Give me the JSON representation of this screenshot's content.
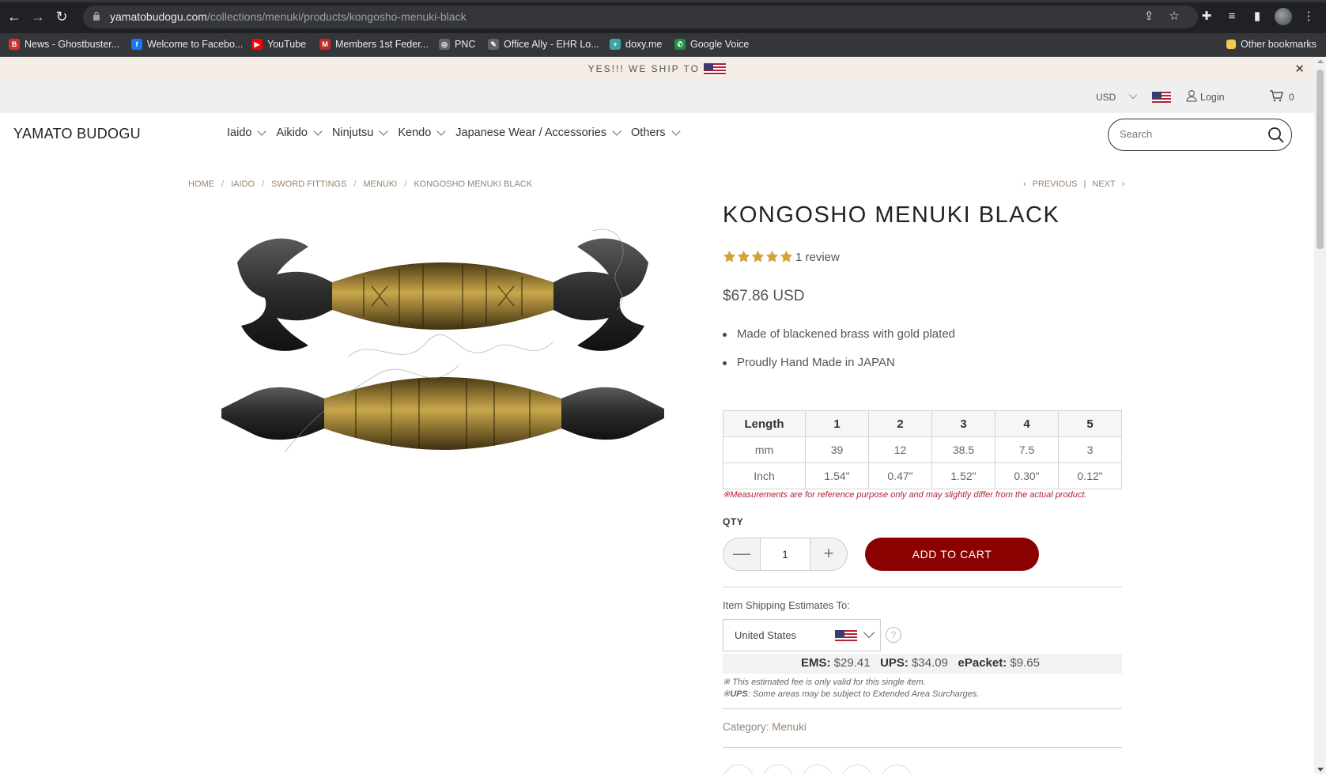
{
  "browser": {
    "url_host": "yamatobudogu.com",
    "url_path": "/collections/menuki/products/kongosho-menuki-black",
    "bookmarks": [
      {
        "label": "News - Ghostbuster...",
        "fav": "B",
        "color": "#d32f2f"
      },
      {
        "label": "Welcome to Facebo...",
        "fav": "f",
        "color": "#1877f2"
      },
      {
        "label": "YouTube",
        "fav": "▶",
        "color": "#ff0000"
      },
      {
        "label": "Members 1st Feder...",
        "fav": "M",
        "color": "#c62828"
      },
      {
        "label": "PNC",
        "fav": "◎",
        "color": "#5f6368"
      },
      {
        "label": "Office Ally - EHR Lo...",
        "fav": "✎",
        "color": "#5f6368"
      },
      {
        "label": "doxy.me",
        "fav": "+",
        "color": "#3aa6a0"
      },
      {
        "label": "Google Voice",
        "fav": "✆",
        "color": "#1e8e3e"
      }
    ],
    "other_bookmarks": "Other bookmarks"
  },
  "promo": {
    "text": "YES!!! WE SHIP TO"
  },
  "util": {
    "currency": "USD",
    "login": "Login",
    "cart_count": "0"
  },
  "header": {
    "logo": "YAMATO BUDOGU",
    "menu": [
      "Iaido",
      "Aikido",
      "Ninjutsu",
      "Kendo",
      "Japanese Wear / Accessories",
      "Others"
    ],
    "search_placeholder": "Search"
  },
  "breadcrumb": [
    "HOME",
    "IAIDO",
    "SWORD FITTINGS",
    "MENUKI",
    "KONGOSHO MENUKI BLACK"
  ],
  "pager": {
    "previous": "PREVIOUS",
    "sep": "|",
    "next": "NEXT"
  },
  "product": {
    "title": "KONGOSHO MENUKI BLACK",
    "rating": 5,
    "review_count": "1 review",
    "price": "$67.86 USD",
    "features": [
      "Made of blackened brass with gold plated",
      "Proudly Hand Made in JAPAN"
    ],
    "spec_table": {
      "headers": [
        "Length",
        "1",
        "2",
        "3",
        "4",
        "5"
      ],
      "rows": [
        [
          "mm",
          "39",
          "12",
          "38.5",
          "7.5",
          "3"
        ],
        [
          "Inch",
          "1.54\"",
          "0.47\"",
          "1.52\"",
          "0.30\"",
          "0.12\""
        ]
      ]
    },
    "measure_note": "※Measurements are for reference purpose only and may slightly differ from the actual product.",
    "qty_label": "QTY",
    "qty": "1",
    "add_to_cart": "ADD TO CART"
  },
  "shipping": {
    "label": "Item Shipping Estimates To:",
    "country": "United States",
    "ems_label": "EMS:",
    "ems": "$29.41",
    "ups_label": "UPS:",
    "ups": "$34.09",
    "epacket_label": "ePacket:",
    "epacket": "$9.65",
    "note1": "※ This estimated fee is only valid for this single item.",
    "note2_prefix": "※",
    "note2_bold": "UPS",
    "note2": ": Some areas may be subject to Extended Area Surcharges."
  },
  "category": {
    "label": "Category:",
    "value": "Menuki"
  },
  "colors": {
    "accent": "#8b0000",
    "link": "#9a8470",
    "promo_bg": "#f3ede6"
  }
}
